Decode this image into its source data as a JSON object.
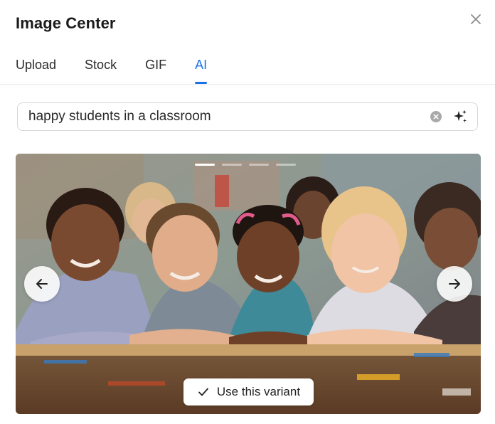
{
  "dialog": {
    "title": "Image Center",
    "close_icon": "close-icon"
  },
  "tabs": [
    {
      "label": "Upload",
      "active": false
    },
    {
      "label": "Stock",
      "active": false
    },
    {
      "label": "GIF",
      "active": false
    },
    {
      "label": "AI",
      "active": true
    }
  ],
  "search": {
    "value": "happy students in a classroom",
    "clear_icon": "clear-icon",
    "generate_icon": "sparkle-icon"
  },
  "carousel": {
    "slide_count": 4,
    "active_index": 0,
    "prev_icon": "arrow-left-icon",
    "next_icon": "arrow-right-icon",
    "image_description_icon": "generated-image"
  },
  "actions": {
    "use_variant_label": "Use this variant",
    "use_variant_icon": "check-icon"
  },
  "colors": {
    "accent": "#1a73e8"
  }
}
